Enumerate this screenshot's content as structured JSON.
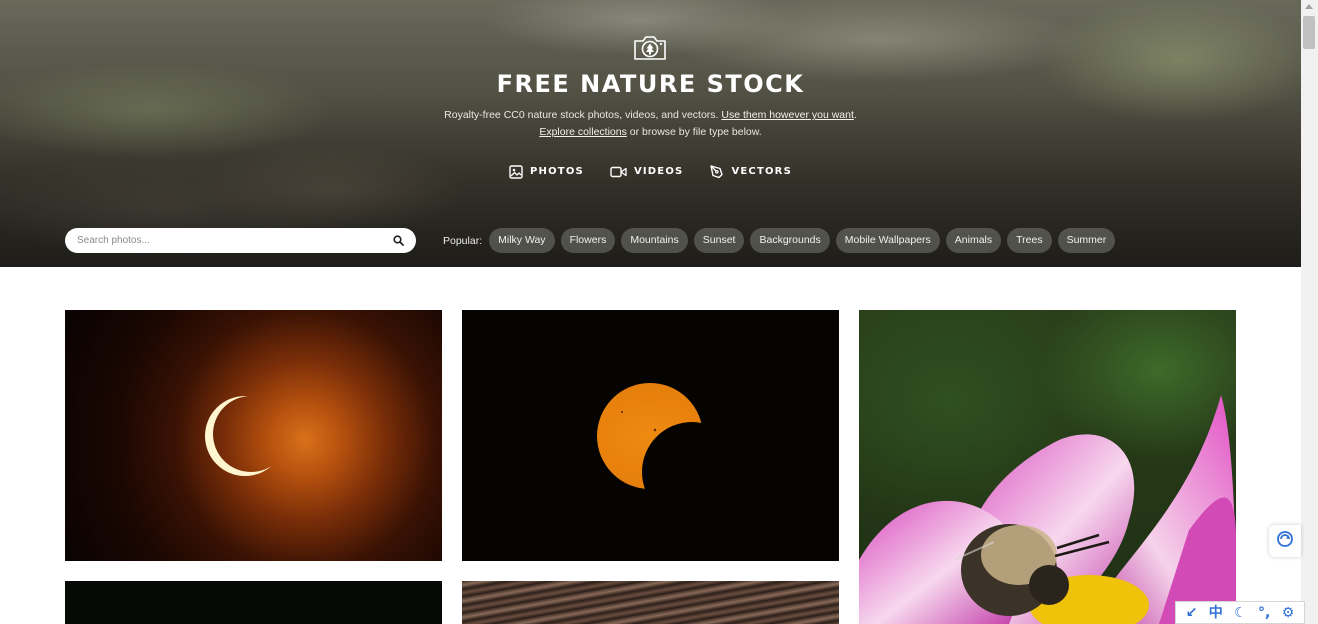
{
  "hero": {
    "title": "FREE NATURE STOCK",
    "tagline_part1": "Royalty-free CC0 nature stock photos, videos, and vectors.",
    "tagline_link1": "Use them however you want",
    "tagline_part2": ".",
    "tagline_link2": "Explore collections",
    "tagline_part3": "or browse by file type below.",
    "logo_icon": "camera-tree-icon"
  },
  "file_types": [
    {
      "label": "PHOTOS",
      "icon": "image-icon"
    },
    {
      "label": "VIDEOS",
      "icon": "video-camera-icon"
    },
    {
      "label": "VECTORS",
      "icon": "pen-tool-icon"
    }
  ],
  "search": {
    "placeholder": "Search photos...",
    "value": "",
    "icon": "search-icon"
  },
  "popular": {
    "label": "Popular:",
    "tags": [
      "Milky Way",
      "Flowers",
      "Mountains",
      "Sunset",
      "Backgrounds",
      "Mobile Wallpapers",
      "Animals",
      "Trees",
      "Summer"
    ]
  },
  "photos": [
    {
      "subject": "crescent solar eclipse"
    },
    {
      "subject": "partial solar eclipse"
    },
    {
      "subject": "bee on pink cosmos flower"
    },
    {
      "subject": "dark landscape"
    },
    {
      "subject": "ocean waves"
    }
  ],
  "ime_toolbar": {
    "items": [
      "↙",
      "中",
      "☾",
      "°,",
      "⚙"
    ]
  },
  "colors": {
    "hero_text": "#ffffff",
    "tag_bg": "#78786f",
    "ime_blue": "#2f6fd6"
  }
}
